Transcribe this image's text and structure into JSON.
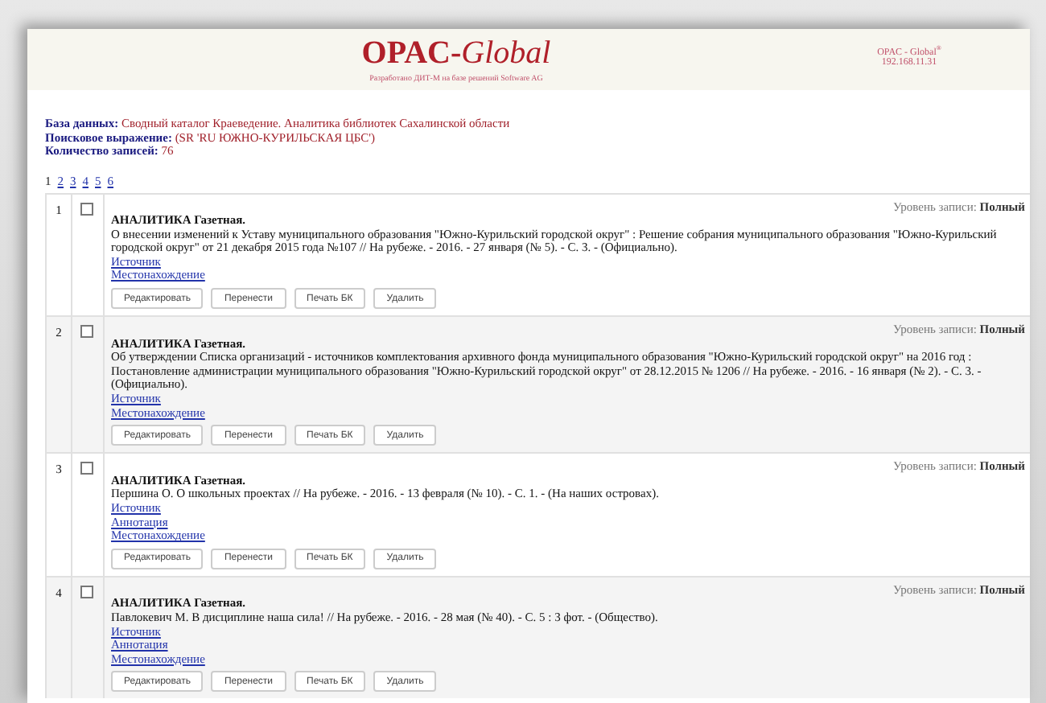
{
  "header": {
    "title": "OPAC-",
    "title_italic": "Global",
    "subtitle": "Разработано ДИТ-М на базе решений Software AG",
    "right_title": "OPAC - Global",
    "right_mark": "®",
    "address": "192.168.11.31"
  },
  "info": [
    {
      "label": "База данных:",
      "value": "Сводный каталог Краеведение. Аналитика библиотек Сахалинской области"
    },
    {
      "label": "Поисковое выражение:",
      "value": "(SR 'RU ЮЖНО-КУРИЛЬСКАЯ ЦБС')"
    },
    {
      "label": "Количество записей:",
      "value": "76"
    }
  ],
  "pages": [
    {
      "label": "1",
      "selected": true
    },
    {
      "label": "2",
      "selected": false
    },
    {
      "label": "3",
      "selected": false
    },
    {
      "label": "4",
      "selected": false
    },
    {
      "label": "5",
      "selected": false
    },
    {
      "label": "6",
      "selected": false
    }
  ],
  "records": [
    {
      "number": "1",
      "checked": false,
      "level_label": "Уровень записи:",
      "level_value": "Полный",
      "title": "АНАЛИТИКА Газетная.",
      "description": "О внесении изменений к Уставу муниципального образования \"Южно-Курильский городской округ\" : Решение собрания муниципального образования \"Южно-Курильский городской округ\" от 21 декабря 2015 года №107 // На рубеже. - 2016. - 27 января (№ 5). - С. 3. - (Официально).",
      "links": [
        "Источник",
        "Местонахождение"
      ],
      "buttons": [
        "Редактировать",
        "Перенести",
        "Печать БК",
        "Удалить"
      ]
    },
    {
      "number": "2",
      "checked": false,
      "level_label": "Уровень записи:",
      "level_value": "Полный",
      "title": "АНАЛИТИКА Газетная.",
      "description": "Об утверждении Списка организаций - источников комплектования архивного фонда муниципального образования \"Южно-Курильский городской округ\" на 2016 год : Постановление администрации муниципального образования \"Южно-Курильский городской округ\" от 28.12.2015 № 1206 // На рубеже. - 2016. - 16 января (№ 2). - С. 3. - (Официально).",
      "links": [
        "Источник",
        "Местонахождение"
      ],
      "buttons": [
        "Редактировать",
        "Перенести",
        "Печать БК",
        "Удалить"
      ]
    },
    {
      "number": "3",
      "checked": false,
      "level_label": "Уровень записи:",
      "level_value": "Полный",
      "title": "АНАЛИТИКА Газетная.",
      "description": "Першина О. О школьных проектах // На рубеже. - 2016. - 13 февраля (№ 10). - С. 1. - (На наших островах).",
      "links": [
        "Источник",
        "Аннотация",
        "Местонахождение"
      ],
      "buttons": [
        "Редактировать",
        "Перенести",
        "Печать БК",
        "Удалить"
      ]
    },
    {
      "number": "4",
      "checked": false,
      "level_label": "Уровень записи:",
      "level_value": "Полный",
      "title": "АНАЛИТИКА Газетная.",
      "description": "Павлокевич М. В дисциплине наша сила! // На рубеже. - 2016. - 28 мая (№ 40). - С. 5 : 3 фот. - (Общество).",
      "links": [
        "Источник",
        "Аннотация",
        "Местонахождение"
      ],
      "buttons": [
        "Редактировать",
        "Перенести",
        "Печать БК",
        "Удалить"
      ]
    }
  ]
}
